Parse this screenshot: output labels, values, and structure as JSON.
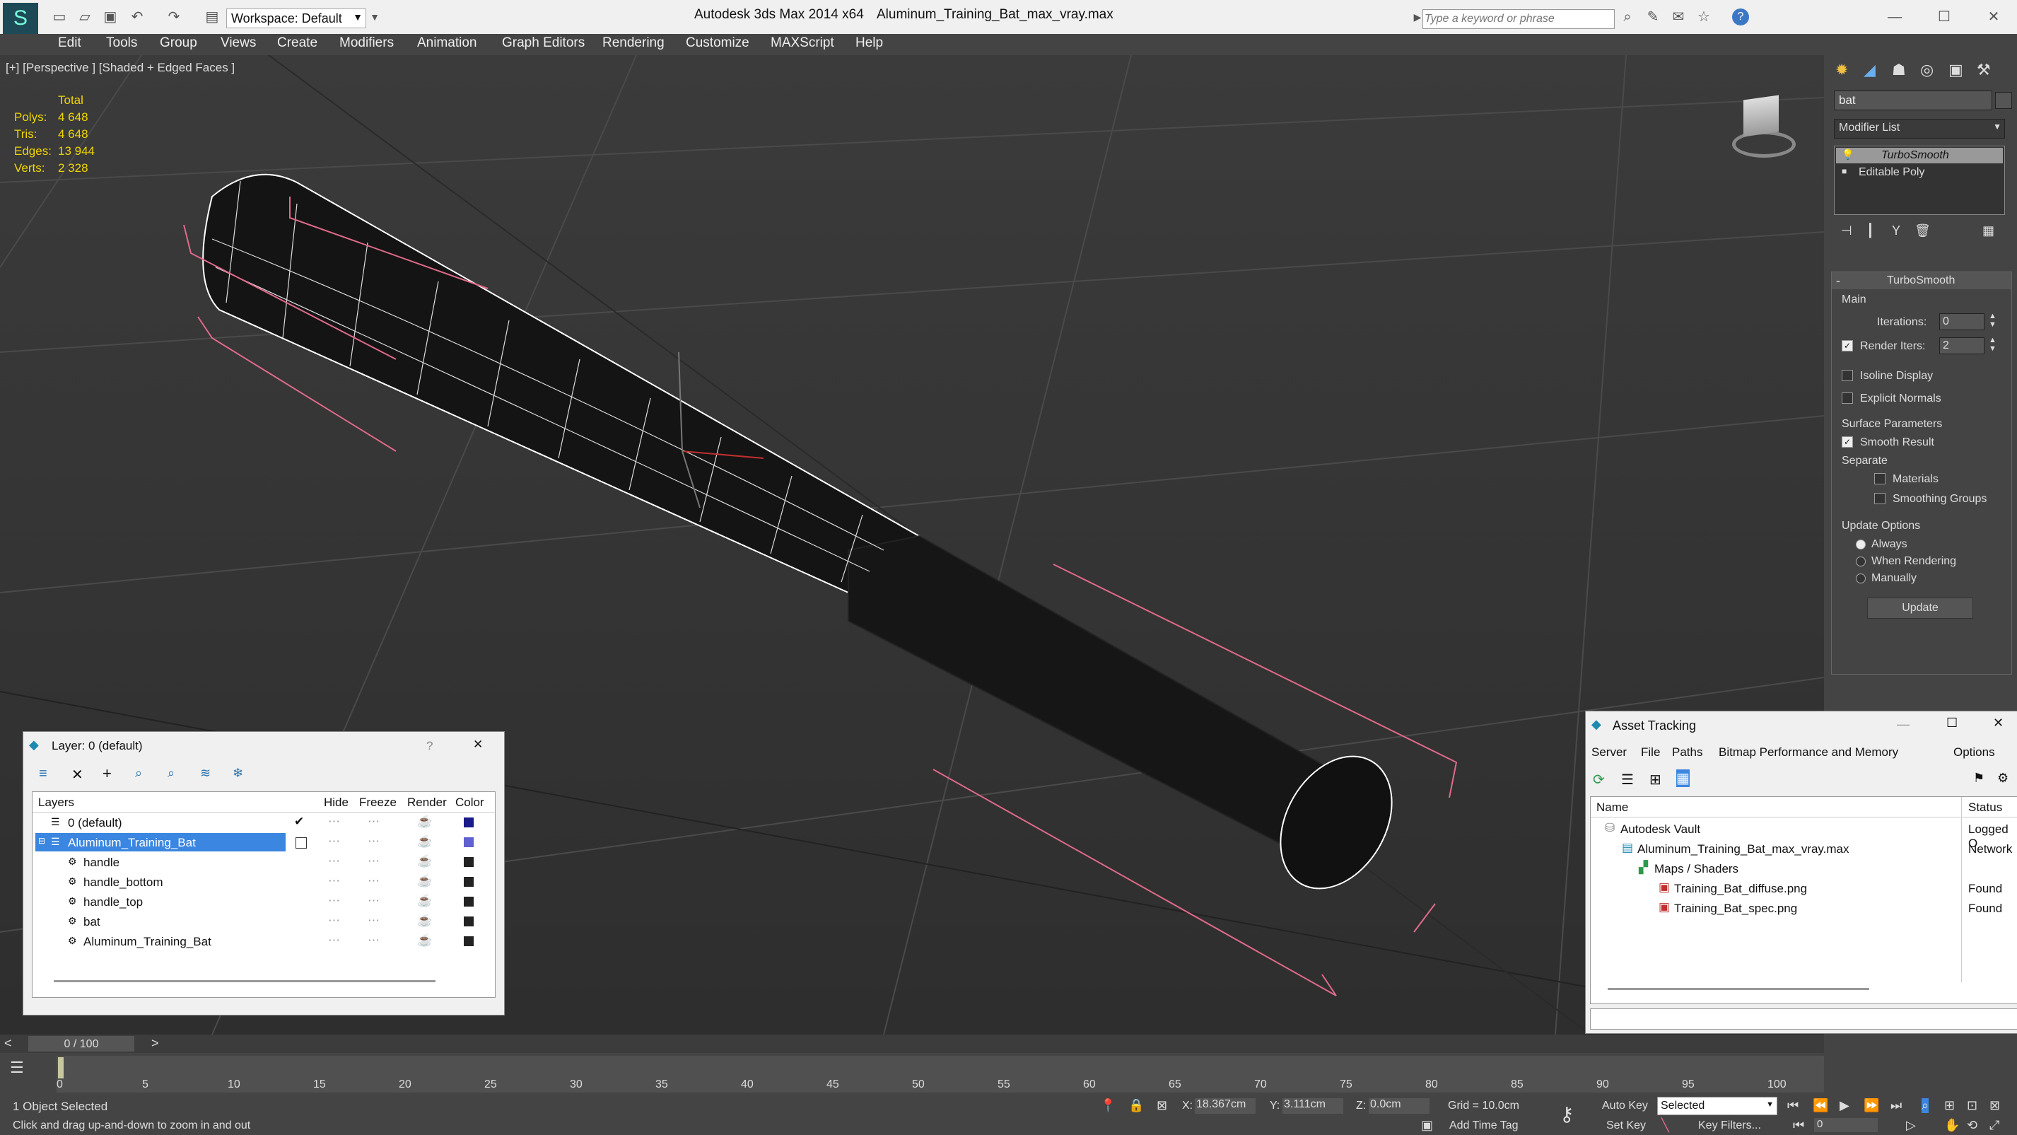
{
  "app": {
    "title": "Autodesk 3ds Max  2014 x64",
    "file": "Aluminum_Training_Bat_max_vray.max",
    "workspace": "Workspace: Default",
    "search_placeholder": "Type a keyword or phrase"
  },
  "menu": [
    "Edit",
    "Tools",
    "Group",
    "Views",
    "Create",
    "Modifiers",
    "Animation",
    "Graph Editors",
    "Rendering",
    "Customize",
    "MAXScript",
    "Help"
  ],
  "viewport": {
    "label": "[+] [Perspective ] [Shaded + Edged Faces ]",
    "stats": {
      "header": "Total",
      "rows": [
        {
          "label": "Polys:",
          "value": "4 648"
        },
        {
          "label": "Tris:",
          "value": "4 648"
        },
        {
          "label": "Edges:",
          "value": "13 944"
        },
        {
          "label": "Verts:",
          "value": "2 328"
        }
      ]
    }
  },
  "command_panel": {
    "object_name": "bat",
    "modifier_list": "Modifier List",
    "stack": [
      "TurboSmooth",
      "Editable Poly"
    ],
    "rollout_title": "TurboSmooth",
    "main_group": "Main",
    "iterations_label": "Iterations:",
    "iterations_value": "0",
    "render_iters_label": "Render Iters:",
    "render_iters_value": "2",
    "isoline": "Isoline Display",
    "explicit_normals": "Explicit Normals",
    "surface_group": "Surface Parameters",
    "smooth_result": "Smooth Result",
    "separate": "Separate",
    "materials": "Materials",
    "smoothing_groups": "Smoothing Groups",
    "update_group": "Update Options",
    "always": "Always",
    "when_rendering": "When Rendering",
    "manually": "Manually",
    "update_button": "Update"
  },
  "layer_dialog": {
    "title": "Layer: 0 (default)",
    "help": "?",
    "columns": [
      "Layers",
      "Hide",
      "Freeze",
      "Render",
      "Color"
    ],
    "rows": [
      {
        "name": "0 (default)",
        "color": "#1a1a8a"
      },
      {
        "name": "Aluminum_Training_Bat",
        "color": "#6060d0"
      },
      {
        "name": "handle",
        "color": "#222222"
      },
      {
        "name": "handle_bottom",
        "color": "#222222"
      },
      {
        "name": "handle_top",
        "color": "#222222"
      },
      {
        "name": "bat",
        "color": "#222222"
      },
      {
        "name": "Aluminum_Training_Bat",
        "color": "#222222"
      }
    ]
  },
  "asset_dialog": {
    "title": "Asset Tracking",
    "menu": [
      "Server",
      "File",
      "Paths",
      "Bitmap Performance and Memory",
      "Options"
    ],
    "columns": [
      "Name",
      "Status"
    ],
    "rows": [
      {
        "name": "Autodesk Vault",
        "status": "Logged O"
      },
      {
        "name": "Aluminum_Training_Bat_max_vray.max",
        "status": "Network"
      },
      {
        "name": "Maps / Shaders",
        "status": ""
      },
      {
        "name": "Training_Bat_diffuse.png",
        "status": "Found"
      },
      {
        "name": "Training_Bat_spec.png",
        "status": "Found"
      }
    ]
  },
  "timeline": {
    "frame": "0 / 100",
    "ticks": [
      "0",
      "5",
      "10",
      "15",
      "20",
      "25",
      "30",
      "35",
      "40",
      "45",
      "50",
      "55",
      "60",
      "65",
      "70",
      "75",
      "80",
      "85",
      "90",
      "95",
      "100"
    ]
  },
  "status": {
    "selected": "1 Object Selected",
    "prompt": "Click and drag up-and-down to zoom in and out",
    "x_label": "X:",
    "x_value": "18.367cm",
    "y_label": "Y:",
    "y_value": "3.111cm",
    "z_label": "Z:",
    "z_value": "0.0cm",
    "grid": "Grid = 10.0cm",
    "add_time_tag": "Add Time Tag",
    "auto_key": "Auto Key",
    "set_key": "Set Key",
    "key_mode": "Selected",
    "key_filters": "Key Filters...",
    "frame_field": "0"
  }
}
